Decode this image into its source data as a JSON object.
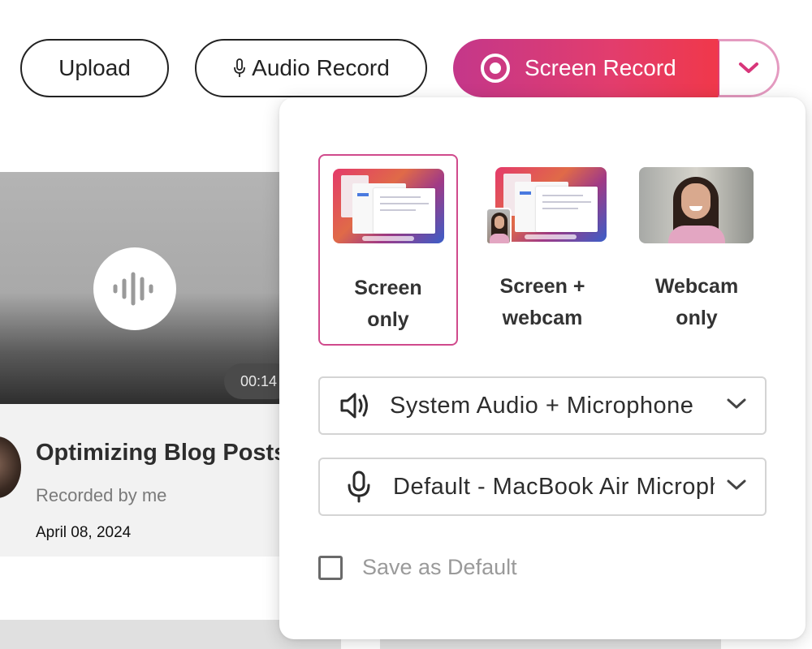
{
  "toolbar": {
    "upload_label": "Upload",
    "audio_record_label": "Audio Record",
    "screen_record_label": "Screen Record"
  },
  "card": {
    "duration": "00:14",
    "title": "Optimizing Blog Posts",
    "recorded_by": "Recorded by me",
    "date": "April 08, 2024"
  },
  "panel": {
    "modes": [
      {
        "line1": "Screen",
        "line2": "only",
        "selected": true
      },
      {
        "line1": "Screen +",
        "line2": "webcam",
        "selected": false
      },
      {
        "line1": "Webcam",
        "line2": "only",
        "selected": false
      }
    ],
    "audio_source": "System Audio + Microphone",
    "microphone": "Default - MacBook Air Microphone",
    "save_default_label": "Save as Default",
    "save_default_checked": false
  },
  "colors": {
    "accent_start": "#c4378a",
    "accent_end": "#f0384a",
    "selected_border": "#d04a8c"
  }
}
